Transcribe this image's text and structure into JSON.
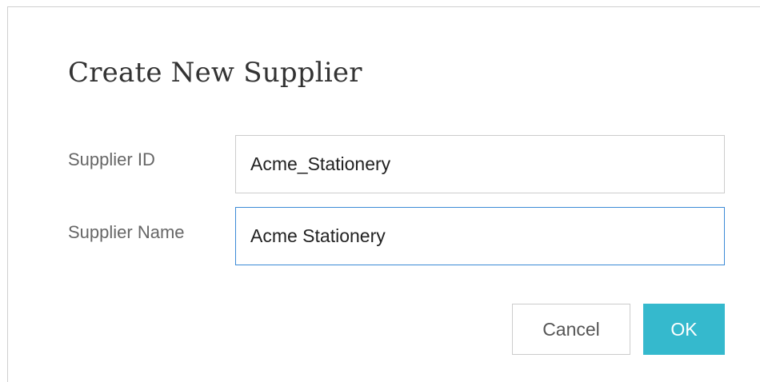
{
  "dialog": {
    "title": "Create New Supplier",
    "fields": {
      "supplier_id": {
        "label": "Supplier ID",
        "value": "Acme_Stationery"
      },
      "supplier_name": {
        "label": "Supplier Name",
        "value": "Acme Stationery",
        "focused": true
      }
    },
    "buttons": {
      "cancel_label": "Cancel",
      "ok_label": "OK"
    },
    "colors": {
      "ok_button": "#35b9cd",
      "focus_border": "#3c8ad6",
      "title_text": "#333333",
      "label_text": "#666666"
    }
  }
}
